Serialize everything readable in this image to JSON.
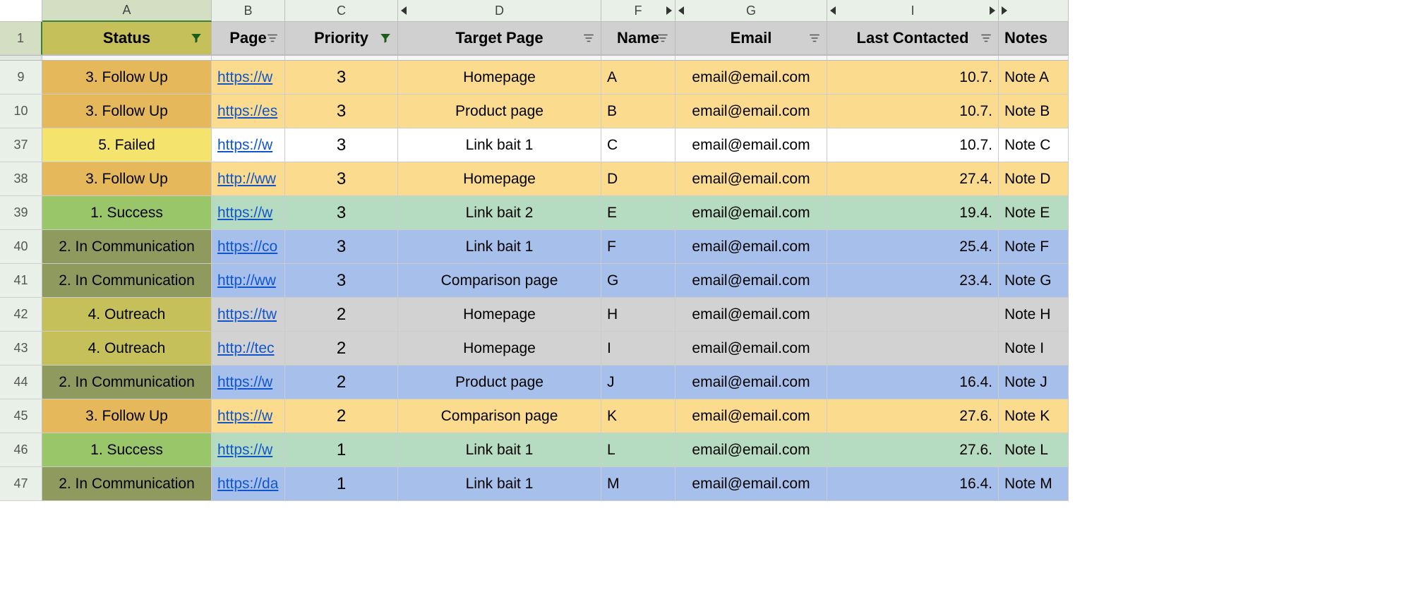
{
  "columns": {
    "A": "A",
    "B": "B",
    "C": "C",
    "D": "D",
    "F": "F",
    "G": "G",
    "I": "I"
  },
  "headers": {
    "status": "Status",
    "page": "Page",
    "priority": "Priority",
    "target": "Target Page",
    "name": "Name",
    "email": "Email",
    "last": "Last Contacted",
    "notes": "Notes"
  },
  "rows": [
    {
      "n": "9",
      "status": "3. Follow Up",
      "statusClass": "status-followup",
      "rowClass": "row-orange",
      "page": "https://w",
      "priority": "3",
      "target": "Homepage",
      "name": "A",
      "email": "email@email.com",
      "last": "10.7.",
      "notes": "Note A"
    },
    {
      "n": "10",
      "status": "3. Follow Up",
      "statusClass": "status-followup",
      "rowClass": "row-orange",
      "page": "https://es",
      "priority": "3",
      "target": "Product page",
      "name": "B",
      "email": "email@email.com",
      "last": "10.7.",
      "notes": "Note B"
    },
    {
      "n": "37",
      "status": "5. Failed",
      "statusClass": "status-failed",
      "rowClass": "row-white",
      "page": "https://w",
      "priority": "3",
      "target": "Link bait 1",
      "name": "C",
      "email": "email@email.com",
      "last": "10.7.",
      "notes": "Note C"
    },
    {
      "n": "38",
      "status": "3. Follow Up",
      "statusClass": "status-followup",
      "rowClass": "row-orange",
      "page": "http://ww",
      "priority": "3",
      "target": "Homepage",
      "name": "D",
      "email": "email@email.com",
      "last": "27.4.",
      "notes": "Note D"
    },
    {
      "n": "39",
      "status": "1. Success",
      "statusClass": "status-success",
      "rowClass": "row-green",
      "page": "https://w",
      "priority": "3",
      "target": "Link bait 2",
      "name": "E",
      "email": "email@email.com",
      "last": "19.4.",
      "notes": "Note E"
    },
    {
      "n": "40",
      "status": "2. In Communication",
      "statusClass": "status-incomm",
      "rowClass": "row-blue",
      "page": "https://co",
      "priority": "3",
      "target": "Link bait 1",
      "name": "F",
      "email": "email@email.com",
      "last": "25.4.",
      "notes": "Note F"
    },
    {
      "n": "41",
      "status": "2. In Communication",
      "statusClass": "status-incomm",
      "rowClass": "row-blue",
      "page": "http://ww",
      "priority": "3",
      "target": "Comparison page",
      "name": "G",
      "email": "email@email.com",
      "last": "23.4.",
      "notes": "Note G"
    },
    {
      "n": "42",
      "status": "4. Outreach",
      "statusClass": "status-outreach",
      "rowClass": "row-grey",
      "page": "https://tw",
      "priority": "2",
      "target": "Homepage",
      "name": "H",
      "email": "email@email.com",
      "last": "",
      "notes": "Note H"
    },
    {
      "n": "43",
      "status": "4. Outreach",
      "statusClass": "status-outreach",
      "rowClass": "row-grey",
      "page": "http://tec",
      "priority": "2",
      "target": "Homepage",
      "name": "I",
      "email": "email@email.com",
      "last": "",
      "notes": "Note I"
    },
    {
      "n": "44",
      "status": "2. In Communication",
      "statusClass": "status-incomm",
      "rowClass": "row-blue",
      "page": "https://w",
      "priority": "2",
      "target": "Product page",
      "name": "J",
      "email": "email@email.com",
      "last": "16.4.",
      "notes": "Note J"
    },
    {
      "n": "45",
      "status": "3. Follow Up",
      "statusClass": "status-followup",
      "rowClass": "row-orange",
      "page": "https://w",
      "priority": "2",
      "target": "Comparison page",
      "name": "K",
      "email": "email@email.com",
      "last": "27.6.",
      "notes": "Note K"
    },
    {
      "n": "46",
      "status": "1. Success",
      "statusClass": "status-success",
      "rowClass": "row-green",
      "page": "https://w",
      "priority": "1",
      "target": "Link bait 1",
      "name": "L",
      "email": "email@email.com",
      "last": "27.6.",
      "notes": "Note L"
    },
    {
      "n": "47",
      "status": "2. In Communication",
      "statusClass": "status-incomm",
      "rowClass": "row-blue",
      "page": "https://da",
      "priority": "1",
      "target": "Link bait 1",
      "name": "M",
      "email": "email@email.com",
      "last": "16.4.",
      "notes": "Note M"
    }
  ],
  "headerRowNum": "1"
}
